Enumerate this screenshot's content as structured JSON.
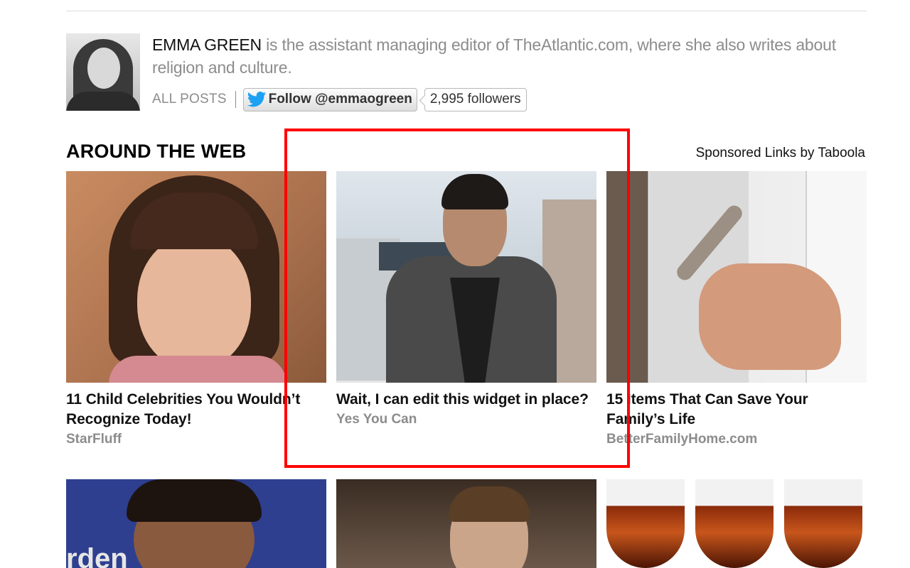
{
  "author": {
    "name": "EMMA GREEN",
    "bio": " is the assistant managing editor of TheAtlantic.com, where she also writes about religion and culture.",
    "all_posts": "ALL POSTS",
    "follow_label": "Follow @emmaogreen",
    "followers": "2,995 followers"
  },
  "section": {
    "title": "AROUND THE WEB",
    "sponsored": "Sponsored Links by Taboola"
  },
  "cards": [
    {
      "title": "11 Child Celebrities You Wouldn’t Recognize Today!",
      "source": "StarFluff"
    },
    {
      "title": "Wait, I can edit this widget in place?",
      "source": "Yes You Can"
    },
    {
      "title": "15 Items That Can Save Your Family’s Life",
      "source": "BetterFamilyHome.com"
    }
  ],
  "row2_partial_text": "rden",
  "colors": {
    "highlight": "#ff0000",
    "muted_text": "#8c8c8c",
    "twitter_blue": "#1da1f2"
  }
}
